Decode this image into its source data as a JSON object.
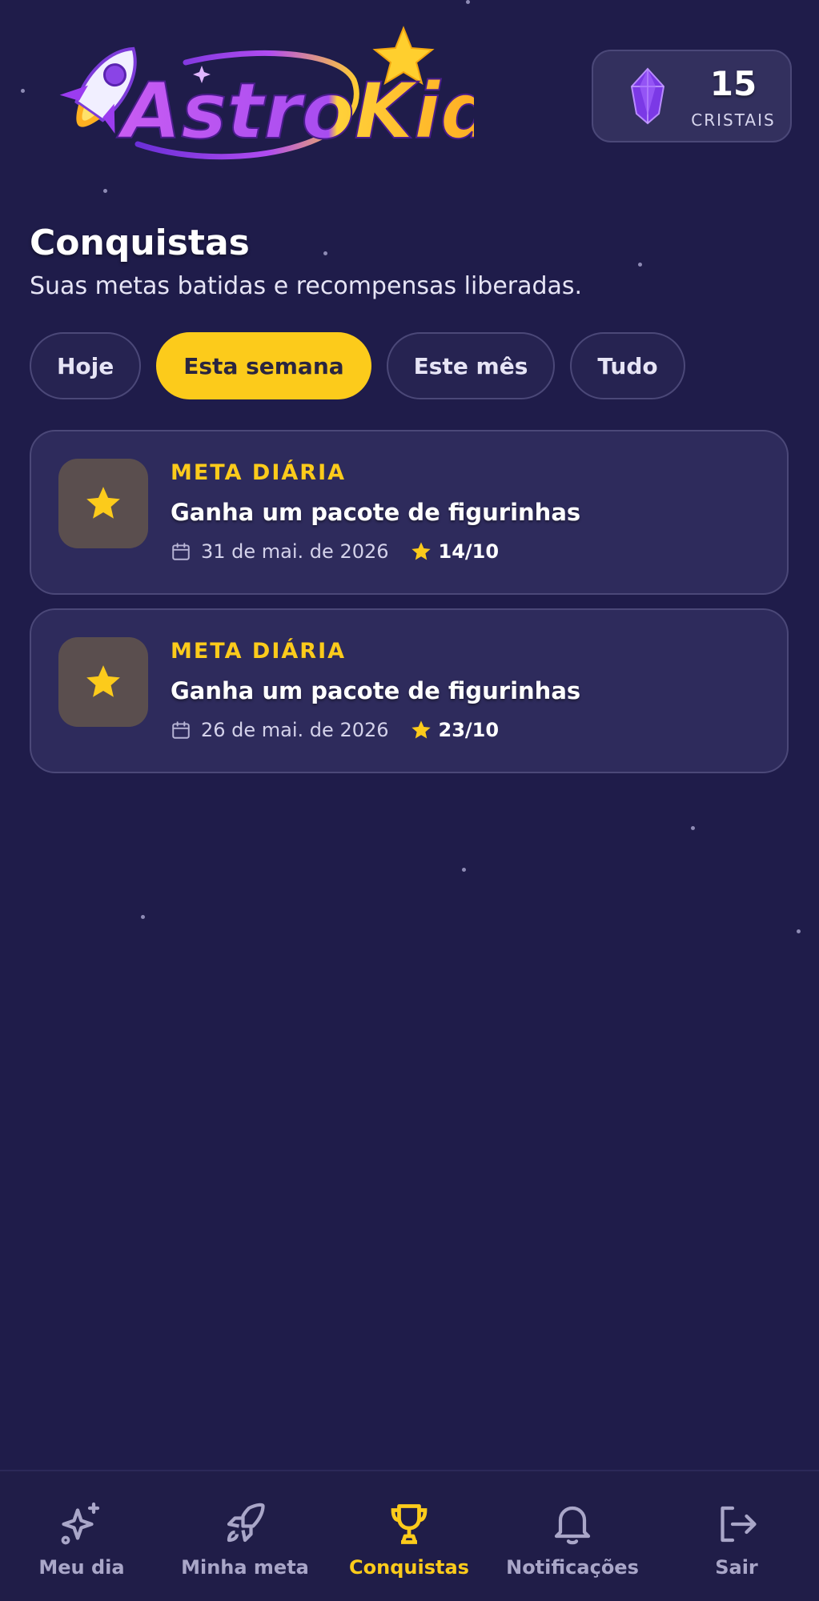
{
  "header": {
    "logo_text": "AstroKids",
    "crystals": {
      "count": "15",
      "label": "CRISTAIS"
    }
  },
  "page": {
    "title": "Conquistas",
    "subtitle": "Suas metas batidas e recompensas liberadas."
  },
  "filters": [
    {
      "label": "Hoje",
      "active": false
    },
    {
      "label": "Esta semana",
      "active": true
    },
    {
      "label": "Este mês",
      "active": false
    },
    {
      "label": "Tudo",
      "active": false
    }
  ],
  "achievements": [
    {
      "kind": "META DIÁRIA",
      "title": "Ganha um pacote de figurinhas",
      "date": "31 de mai. de 2026",
      "score": "14/10",
      "icon": "star-icon"
    },
    {
      "kind": "META DIÁRIA",
      "title": "Ganha um pacote de figurinhas",
      "date": "26 de mai. de 2026",
      "score": "23/10",
      "icon": "star-icon"
    }
  ],
  "nav": [
    {
      "label": "Meu dia",
      "icon": "sparkles-icon",
      "active": false
    },
    {
      "label": "Minha meta",
      "icon": "rocket-icon",
      "active": false
    },
    {
      "label": "Conquistas",
      "icon": "trophy-icon",
      "active": true
    },
    {
      "label": "Notificações",
      "icon": "bell-icon",
      "active": false
    },
    {
      "label": "Sair",
      "icon": "logout-icon",
      "active": false
    }
  ],
  "colors": {
    "background": "#1f1c4a",
    "accent_yellow": "#fccb1b",
    "card": "#2e2b5c",
    "logo_purple": "#9b3cf0"
  }
}
